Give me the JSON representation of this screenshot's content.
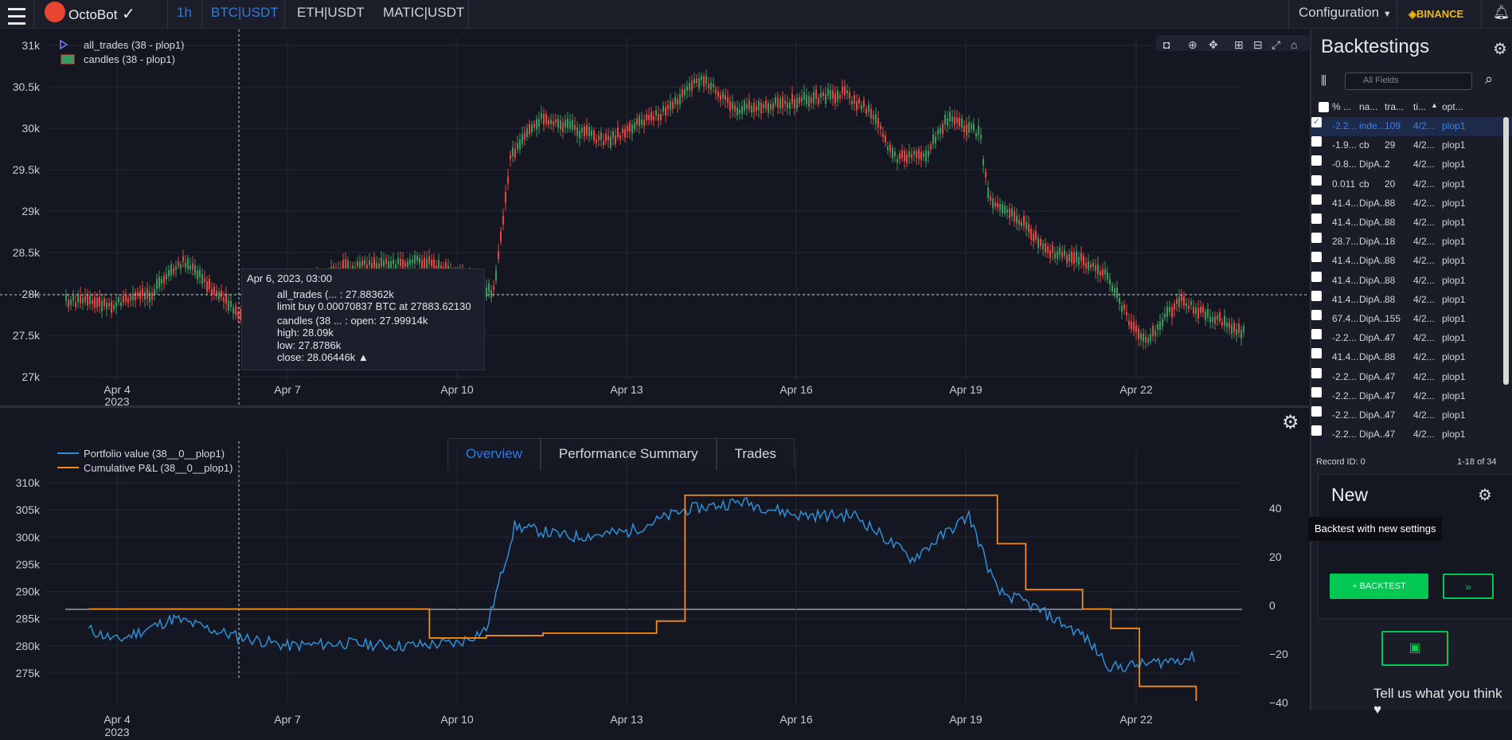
{
  "app": {
    "name": "OctoBot"
  },
  "nav": {
    "timeframe": "1h",
    "pairs": [
      {
        "label": "BTC|USDT",
        "active": true
      },
      {
        "label": "ETH|USDT",
        "active": false
      },
      {
        "label": "MATIC|USDT",
        "active": false
      }
    ],
    "configuration": "Configuration",
    "exchange": "BINANCE"
  },
  "price_chart": {
    "legend": [
      "all_trades (38 - plop1)",
      "candles (38 - plop1)"
    ],
    "y_ticks": [
      "31k",
      "30.5k",
      "30k",
      "29.5k",
      "29k",
      "28.5k",
      "28k",
      "27.5k",
      "27k"
    ],
    "x_ticks": [
      "Apr 4",
      "Apr 7",
      "Apr 10",
      "Apr 13",
      "Apr 16",
      "Apr 19",
      "Apr 22"
    ],
    "x_year": "2023"
  },
  "tooltip": {
    "date": "Apr 6, 2023, 03:00",
    "trades_line": "all_trades (... : 27.88362k",
    "trades_detail": "limit buy 0.00070837 BTC at 27883.62130",
    "candles_line": "candles (38 ... : open: 27.99914k",
    "high": "high: 28.09k",
    "low": "low: 27.8786k",
    "close": "close: 28.06446k"
  },
  "tabs": [
    {
      "label": "Overview",
      "active": true
    },
    {
      "label": "Performance Summary",
      "active": false
    },
    {
      "label": "Trades",
      "active": false
    }
  ],
  "portfolio_chart": {
    "legend": [
      "Portfolio value (38__0__plop1)",
      "Cumulative P&L (38__0__plop1)"
    ],
    "y_ticks": [
      "310k",
      "305k",
      "300k",
      "295k",
      "290k",
      "285k",
      "280k",
      "275k"
    ],
    "y2_ticks": [
      "40",
      "20",
      "0",
      "−20",
      "−40"
    ],
    "x_ticks": [
      "Apr 4",
      "Apr 7",
      "Apr 10",
      "Apr 13",
      "Apr 16",
      "Apr 19",
      "Apr 22"
    ],
    "x_year": "2023"
  },
  "chart_data": {
    "type": "line",
    "title": "",
    "series": [
      {
        "name": "Portfolio value (38__0__plop1)",
        "color": "#2f8fd8",
        "x": [
          "Apr 3 12:00",
          "Apr 4",
          "Apr 5",
          "Apr 6",
          "Apr 7",
          "Apr 8",
          "Apr 9",
          "Apr 10",
          "Apr 10 12:00",
          "Apr 11",
          "Apr 12",
          "Apr 13",
          "Apr 14",
          "Apr 15",
          "Apr 16",
          "Apr 17",
          "Apr 18",
          "Apr 19",
          "Apr 19 12:00",
          "Apr 20",
          "Apr 21",
          "Apr 21 12:00",
          "Apr 22",
          "Apr 23"
        ],
        "values": [
          283000,
          281000,
          285000,
          282000,
          280000,
          280500,
          280000,
          280500,
          283000,
          302000,
          300000,
          301000,
          305000,
          306500,
          304000,
          304000,
          296000,
          304000,
          290000,
          288000,
          282000,
          276000,
          276500,
          278000
        ]
      },
      {
        "name": "Cumulative P&L (38__0__plop1)",
        "color": "#f28c1b",
        "x": [
          "Apr 3 12:00",
          "Apr 9 12:00",
          "Apr 10 12:00",
          "Apr 11 12:00",
          "Apr 12 12:00",
          "Apr 13 12:00",
          "Apr 14",
          "Apr 18",
          "Apr 19 12:00",
          "Apr 20",
          "Apr 21",
          "Apr 21 12:00",
          "Apr 22",
          "Apr 23"
        ],
        "values": [
          0,
          -12,
          -11,
          -10,
          -10,
          -5,
          47,
          47,
          27,
          8,
          0,
          -8,
          -32,
          -38
        ]
      }
    ],
    "ylim": [
      273000,
      311000
    ],
    "y2lim": [
      -42,
      52
    ]
  },
  "backtestings": {
    "title": "Backtestings",
    "search_placeholder": "All Fields",
    "headers": [
      "% ...",
      "na...",
      "tra...",
      "ti...",
      "opt..."
    ],
    "rows": [
      [
        "-2.2...",
        "inde...",
        "109",
        "4/2...",
        "plop1"
      ],
      [
        "-1.9...",
        "cb",
        "29",
        "4/2...",
        "plop1"
      ],
      [
        "-0.8...",
        "DipA...",
        "2",
        "4/2...",
        "plop1"
      ],
      [
        "0.011",
        "cb",
        "20",
        "4/2...",
        "plop1"
      ],
      [
        "41.4...",
        "DipA...",
        "88",
        "4/2...",
        "plop1"
      ],
      [
        "41.4...",
        "DipA...",
        "88",
        "4/2...",
        "plop1"
      ],
      [
        "28.7...",
        "DipA...",
        "18",
        "4/2...",
        "plop1"
      ],
      [
        "41.4...",
        "DipA...",
        "88",
        "4/2...",
        "plop1"
      ],
      [
        "41.4...",
        "DipA...",
        "88",
        "4/2...",
        "plop1"
      ],
      [
        "41.4...",
        "DipA...",
        "88",
        "4/2...",
        "plop1"
      ],
      [
        "67.4...",
        "DipA...",
        "155",
        "4/2...",
        "plop1"
      ],
      [
        "-2.2...",
        "DipA...",
        "47",
        "4/2...",
        "plop1"
      ],
      [
        "41.4...",
        "DipA...",
        "88",
        "4/2...",
        "plop1"
      ],
      [
        "-2.2...",
        "DipA...",
        "47",
        "4/2...",
        "plop1"
      ],
      [
        "-2.2...",
        "DipA...",
        "47",
        "4/2...",
        "plop1"
      ],
      [
        "-2.2...",
        "DipA...",
        "47",
        "4/2...",
        "plop1"
      ],
      [
        "-2.2...",
        "DipA...",
        "47",
        "4/2...",
        "plop1"
      ]
    ],
    "record_id": "Record ID: 0",
    "record_range": "1-18 of 34",
    "new_title": "New",
    "tooltip": "Backtest with new settings",
    "backtest_button": "BACKTEST",
    "feedback": "Tell us what you think"
  }
}
